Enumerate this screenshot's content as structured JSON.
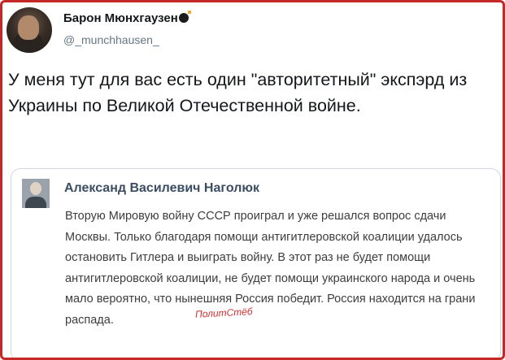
{
  "tweet": {
    "display_name": "Барон Мюнхгаузен",
    "handle": "@_munchhausen_",
    "text": "У меня тут для вас есть один \"авторитетный\" экспэрд из Украины по Великой Отечественной войне."
  },
  "quoted_post": {
    "author": "Александ Василевич Наголюк",
    "text": "Вторую Мировую войну СССР проиграл и уже решался вопрос сдачи Москвы. Только благодаря помощи антигитлеровской коалиции удалось остановить Гитлера и выиграть войну. В этот раз не будет помощи антигитлеровской коалиции, не будет помощи украинского народа и очень мало вероятно, что нынешняя Россия победит. Россия находится на грани распада."
  },
  "watermark": "ПолитСтёб",
  "colors": {
    "frame_border": "#c62828",
    "handle": "#657786",
    "quote_author": "#3b4d63",
    "watermark": "#d32f2f"
  }
}
